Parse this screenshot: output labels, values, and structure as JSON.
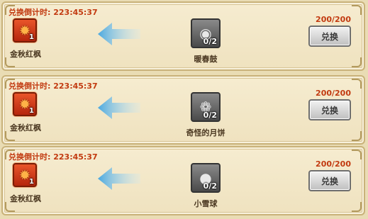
{
  "exchanges": [
    {
      "timer_text": "兑换倒计时: 223:45:37",
      "source_item": {
        "name": "金秋红枫",
        "count": "1",
        "icon": "maple-leaf-icon"
      },
      "target_item": {
        "name": "暖春鼓",
        "count": "0/2",
        "icon": "drum-icon"
      },
      "progress": "200/200",
      "button_label": "兑换"
    },
    {
      "timer_text": "兑换倒计时: 223:45:37",
      "source_item": {
        "name": "金秋红枫",
        "count": "1",
        "icon": "maple-leaf-icon"
      },
      "target_item": {
        "name": "奇怪的月饼",
        "count": "0/2",
        "icon": "mooncake-icon"
      },
      "progress": "200/200",
      "button_label": "兑换"
    },
    {
      "timer_text": "兑换倒计时: 223:45:37",
      "source_item": {
        "name": "金秋红枫",
        "count": "1",
        "icon": "maple-leaf-icon"
      },
      "target_item": {
        "name": "小雪球",
        "count": "0/2",
        "icon": "snowball-icon"
      },
      "progress": "200/200",
      "button_label": "兑换"
    }
  ],
  "colors": {
    "timer": "#c23a10",
    "arrow": "#5fb8ea",
    "panel_bg": "#f6ecd0"
  }
}
